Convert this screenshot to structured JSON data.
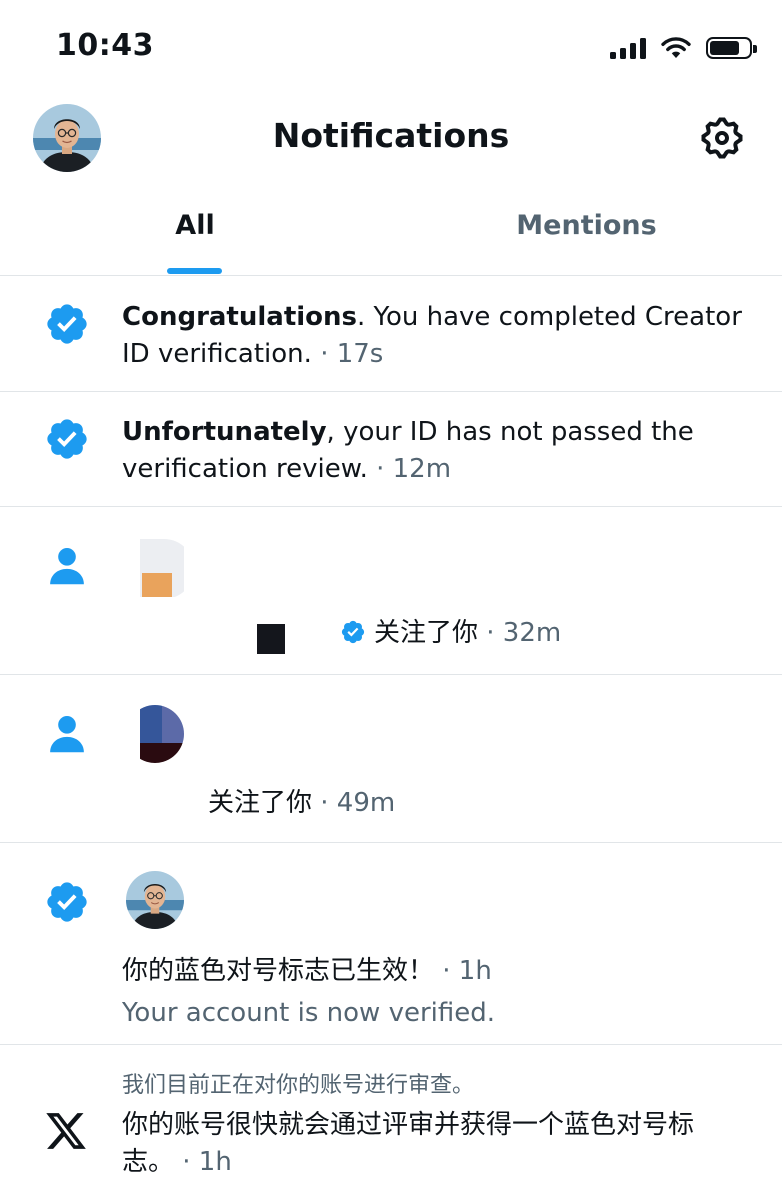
{
  "status_bar": {
    "time": "10:43"
  },
  "header": {
    "title": "Notifications"
  },
  "tabs": [
    {
      "label": "All",
      "selected": true
    },
    {
      "label": "Mentions",
      "selected": false
    }
  ],
  "colors": {
    "accent": "#1d9bf0",
    "text": "#0f1419",
    "muted": "#536471",
    "divider": "#e1e5e8"
  },
  "notifications": [
    {
      "type": "verified",
      "icon": "verified-badge-icon",
      "bold": "Congratulations",
      "body": ".  You have completed Creator ID verification.",
      "time": "· 17s"
    },
    {
      "type": "verified",
      "icon": "verified-badge-icon",
      "bold": "Unfortunately",
      "body": ", your ID has not passed the verification review.",
      "time": "· 12m"
    },
    {
      "type": "follow",
      "icon": "person-icon",
      "text": "关注了你",
      "time": "· 32m"
    },
    {
      "type": "follow",
      "icon": "person-icon",
      "text": "关注了你",
      "time": "· 49m"
    },
    {
      "type": "verified",
      "icon": "verified-badge-icon",
      "text": "你的蓝色对号标志已生效！",
      "time": "· 1h",
      "subtext": "Your account is now verified."
    },
    {
      "type": "x",
      "icon": "x-logo-icon",
      "header": "我们目前正在对你的账号进行审查。",
      "text": "你的账号很快就会通过评审并获得一个蓝色对号标志。",
      "time": "· 1h"
    }
  ]
}
